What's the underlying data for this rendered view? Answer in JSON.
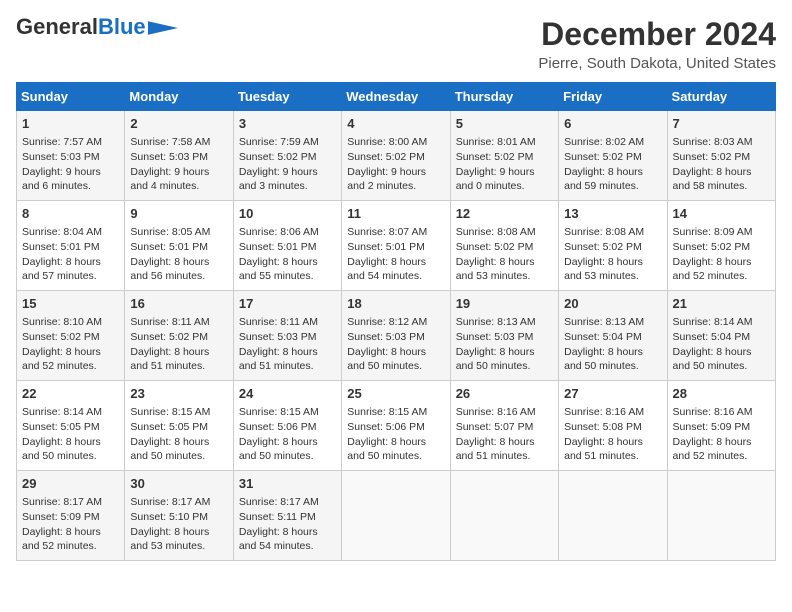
{
  "header": {
    "logo_general": "General",
    "logo_blue": "Blue",
    "title": "December 2024",
    "subtitle": "Pierre, South Dakota, United States"
  },
  "weekdays": [
    "Sunday",
    "Monday",
    "Tuesday",
    "Wednesday",
    "Thursday",
    "Friday",
    "Saturday"
  ],
  "weeks": [
    [
      {
        "day": "1",
        "sunrise": "Sunrise: 7:57 AM",
        "sunset": "Sunset: 5:03 PM",
        "daylight": "Daylight: 9 hours and 6 minutes."
      },
      {
        "day": "2",
        "sunrise": "Sunrise: 7:58 AM",
        "sunset": "Sunset: 5:03 PM",
        "daylight": "Daylight: 9 hours and 4 minutes."
      },
      {
        "day": "3",
        "sunrise": "Sunrise: 7:59 AM",
        "sunset": "Sunset: 5:02 PM",
        "daylight": "Daylight: 9 hours and 3 minutes."
      },
      {
        "day": "4",
        "sunrise": "Sunrise: 8:00 AM",
        "sunset": "Sunset: 5:02 PM",
        "daylight": "Daylight: 9 hours and 2 minutes."
      },
      {
        "day": "5",
        "sunrise": "Sunrise: 8:01 AM",
        "sunset": "Sunset: 5:02 PM",
        "daylight": "Daylight: 9 hours and 0 minutes."
      },
      {
        "day": "6",
        "sunrise": "Sunrise: 8:02 AM",
        "sunset": "Sunset: 5:02 PM",
        "daylight": "Daylight: 8 hours and 59 minutes."
      },
      {
        "day": "7",
        "sunrise": "Sunrise: 8:03 AM",
        "sunset": "Sunset: 5:02 PM",
        "daylight": "Daylight: 8 hours and 58 minutes."
      }
    ],
    [
      {
        "day": "8",
        "sunrise": "Sunrise: 8:04 AM",
        "sunset": "Sunset: 5:01 PM",
        "daylight": "Daylight: 8 hours and 57 minutes."
      },
      {
        "day": "9",
        "sunrise": "Sunrise: 8:05 AM",
        "sunset": "Sunset: 5:01 PM",
        "daylight": "Daylight: 8 hours and 56 minutes."
      },
      {
        "day": "10",
        "sunrise": "Sunrise: 8:06 AM",
        "sunset": "Sunset: 5:01 PM",
        "daylight": "Daylight: 8 hours and 55 minutes."
      },
      {
        "day": "11",
        "sunrise": "Sunrise: 8:07 AM",
        "sunset": "Sunset: 5:01 PM",
        "daylight": "Daylight: 8 hours and 54 minutes."
      },
      {
        "day": "12",
        "sunrise": "Sunrise: 8:08 AM",
        "sunset": "Sunset: 5:02 PM",
        "daylight": "Daylight: 8 hours and 53 minutes."
      },
      {
        "day": "13",
        "sunrise": "Sunrise: 8:08 AM",
        "sunset": "Sunset: 5:02 PM",
        "daylight": "Daylight: 8 hours and 53 minutes."
      },
      {
        "day": "14",
        "sunrise": "Sunrise: 8:09 AM",
        "sunset": "Sunset: 5:02 PM",
        "daylight": "Daylight: 8 hours and 52 minutes."
      }
    ],
    [
      {
        "day": "15",
        "sunrise": "Sunrise: 8:10 AM",
        "sunset": "Sunset: 5:02 PM",
        "daylight": "Daylight: 8 hours and 52 minutes."
      },
      {
        "day": "16",
        "sunrise": "Sunrise: 8:11 AM",
        "sunset": "Sunset: 5:02 PM",
        "daylight": "Daylight: 8 hours and 51 minutes."
      },
      {
        "day": "17",
        "sunrise": "Sunrise: 8:11 AM",
        "sunset": "Sunset: 5:03 PM",
        "daylight": "Daylight: 8 hours and 51 minutes."
      },
      {
        "day": "18",
        "sunrise": "Sunrise: 8:12 AM",
        "sunset": "Sunset: 5:03 PM",
        "daylight": "Daylight: 8 hours and 50 minutes."
      },
      {
        "day": "19",
        "sunrise": "Sunrise: 8:13 AM",
        "sunset": "Sunset: 5:03 PM",
        "daylight": "Daylight: 8 hours and 50 minutes."
      },
      {
        "day": "20",
        "sunrise": "Sunrise: 8:13 AM",
        "sunset": "Sunset: 5:04 PM",
        "daylight": "Daylight: 8 hours and 50 minutes."
      },
      {
        "day": "21",
        "sunrise": "Sunrise: 8:14 AM",
        "sunset": "Sunset: 5:04 PM",
        "daylight": "Daylight: 8 hours and 50 minutes."
      }
    ],
    [
      {
        "day": "22",
        "sunrise": "Sunrise: 8:14 AM",
        "sunset": "Sunset: 5:05 PM",
        "daylight": "Daylight: 8 hours and 50 minutes."
      },
      {
        "day": "23",
        "sunrise": "Sunrise: 8:15 AM",
        "sunset": "Sunset: 5:05 PM",
        "daylight": "Daylight: 8 hours and 50 minutes."
      },
      {
        "day": "24",
        "sunrise": "Sunrise: 8:15 AM",
        "sunset": "Sunset: 5:06 PM",
        "daylight": "Daylight: 8 hours and 50 minutes."
      },
      {
        "day": "25",
        "sunrise": "Sunrise: 8:15 AM",
        "sunset": "Sunset: 5:06 PM",
        "daylight": "Daylight: 8 hours and 50 minutes."
      },
      {
        "day": "26",
        "sunrise": "Sunrise: 8:16 AM",
        "sunset": "Sunset: 5:07 PM",
        "daylight": "Daylight: 8 hours and 51 minutes."
      },
      {
        "day": "27",
        "sunrise": "Sunrise: 8:16 AM",
        "sunset": "Sunset: 5:08 PM",
        "daylight": "Daylight: 8 hours and 51 minutes."
      },
      {
        "day": "28",
        "sunrise": "Sunrise: 8:16 AM",
        "sunset": "Sunset: 5:09 PM",
        "daylight": "Daylight: 8 hours and 52 minutes."
      }
    ],
    [
      {
        "day": "29",
        "sunrise": "Sunrise: 8:17 AM",
        "sunset": "Sunset: 5:09 PM",
        "daylight": "Daylight: 8 hours and 52 minutes."
      },
      {
        "day": "30",
        "sunrise": "Sunrise: 8:17 AM",
        "sunset": "Sunset: 5:10 PM",
        "daylight": "Daylight: 8 hours and 53 minutes."
      },
      {
        "day": "31",
        "sunrise": "Sunrise: 8:17 AM",
        "sunset": "Sunset: 5:11 PM",
        "daylight": "Daylight: 8 hours and 54 minutes."
      },
      null,
      null,
      null,
      null
    ]
  ]
}
